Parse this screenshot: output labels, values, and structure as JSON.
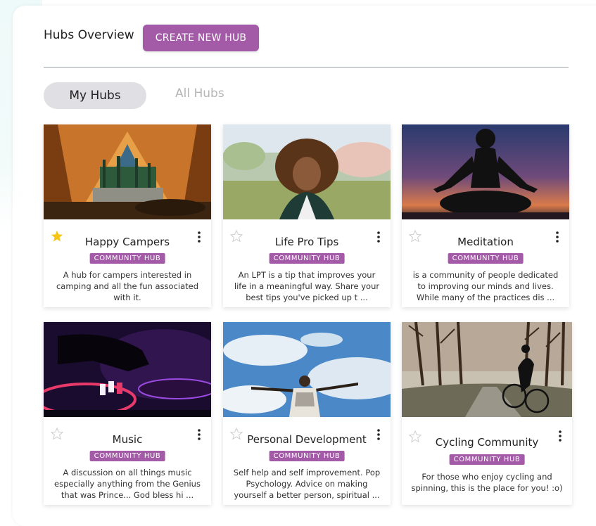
{
  "header": {
    "title": "Hubs Overview",
    "create_label": "CREATE NEW HUB"
  },
  "tabs": [
    {
      "label": "My Hubs",
      "active": true
    },
    {
      "label": "All Hubs",
      "active": false
    }
  ],
  "colors": {
    "accent": "#a35aa7",
    "star_active": "#f5c518",
    "star_inactive": "#d0d0d0"
  },
  "hubs": [
    {
      "name": "Happy Campers",
      "badge": "COMMUNITY HUB",
      "starred": true,
      "image": "tent-camping-forest",
      "description": "A hub for campers interested in camping and all the fun associated with it."
    },
    {
      "name": "Life Pro Tips",
      "badge": "COMMUNITY HUB",
      "starred": false,
      "image": "smiling-woman-curly-hair",
      "description": "An LPT is a tip that improves your life in a meaningful way. Share your best tips you've picked up t ..."
    },
    {
      "name": "Meditation",
      "badge": "COMMUNITY HUB",
      "starred": false,
      "image": "meditation-silhouette-sunset",
      "description": "is a community of people dedicated to improving our minds and lives. While many of the practices dis ..."
    },
    {
      "name": "Music",
      "badge": "COMMUNITY HUB",
      "starred": false,
      "image": "dj-turntable-hand",
      "description": "A discussion on all things music especially anything from the Genius that was Prince... God bless hi ..."
    },
    {
      "name": "Personal Development",
      "badge": "COMMUNITY HUB",
      "starred": false,
      "image": "man-arms-raised-sky",
      "description": "Self help and self improvement. Pop Psychology. Advice on making yourself a better person, spiritual ..."
    },
    {
      "name": "Cycling Community",
      "badge": "COMMUNITY HUB",
      "starred": false,
      "image": "cyclist-tree-lined-road",
      "description": "For those who enjoy cycling and spinning, this is the place for you! :o)"
    }
  ]
}
